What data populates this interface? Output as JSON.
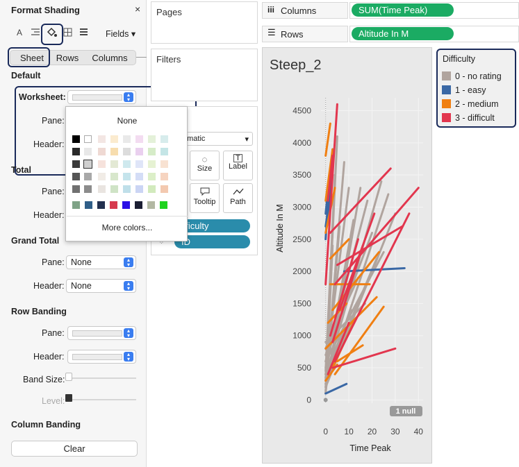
{
  "format_panel": {
    "title": "Format Shading",
    "close": "×",
    "toolbar": {
      "font_icon": "A",
      "fields": "Fields"
    },
    "tabs": [
      "Sheet",
      "Rows",
      "Columns"
    ],
    "default": {
      "heading": "Default",
      "worksheet_label": "Worksheet:",
      "pane_label": "Pane:",
      "header_label": "Header:"
    },
    "total": {
      "heading": "Total",
      "pane_label": "Pane:",
      "header_label": "Header:"
    },
    "grand_total": {
      "heading": "Grand Total",
      "pane_label": "Pane:",
      "pane_value": "None",
      "header_label": "Header:",
      "header_value": "None"
    },
    "row_banding": {
      "heading": "Row Banding",
      "pane_label": "Pane:",
      "header_label": "Header:",
      "band_size_label": "Band Size:",
      "level_label": "Level:"
    },
    "column_banding": {
      "heading": "Column Banding"
    },
    "clear_button": "Clear"
  },
  "color_popup": {
    "none_label": "None",
    "more_colors": "More colors...",
    "recent_colors": [
      "#7fa387",
      "#2f5e88",
      "#22304f",
      "#d63a4e",
      "#2a0fe6",
      "#1b1e33",
      "#b2b8a3",
      "#1fd31f"
    ]
  },
  "cards": {
    "pages": "Pages",
    "filters": "Filters",
    "mark_type": "omatic",
    "size": "Size",
    "label": "Label",
    "tooltip": "Tooltip",
    "path": "Path",
    "color_pill": "ifficulty",
    "detail_pill": "ID"
  },
  "shelves": {
    "columns_label": "Columns",
    "columns_pill": "SUM(Time Peak)",
    "rows_label": "Rows",
    "rows_pill": "Altitude In M"
  },
  "legend": {
    "title": "Difficulty",
    "items": [
      {
        "label": "0 - no rating",
        "color": "#b0a49e"
      },
      {
        "label": "1 - easy",
        "color": "#3a68a5"
      },
      {
        "label": "2 - medium",
        "color": "#f07f12"
      },
      {
        "label": "3 - difficult",
        "color": "#e2364e"
      }
    ]
  },
  "chart_data": {
    "type": "line",
    "title": "Steep_2",
    "xlabel": "Time Peak",
    "ylabel": "Altitude In M",
    "xlim": [
      -2,
      42
    ],
    "ylim": [
      -50,
      4700
    ],
    "x_ticks": [
      0,
      10,
      20,
      30,
      40
    ],
    "y_ticks": [
      0,
      500,
      1000,
      1500,
      2000,
      2500,
      3000,
      3500,
      4000,
      4500
    ],
    "null_indicator": "1 null",
    "series": [
      {
        "name": "0 - no rating",
        "color": "#b0a49e",
        "lines": [
          [
            [
              0,
              300
            ],
            [
              5,
              4100
            ]
          ],
          [
            [
              0,
              200
            ],
            [
              8,
              3700
            ]
          ],
          [
            [
              0,
              400
            ],
            [
              12,
              2800
            ]
          ],
          [
            [
              0,
              150
            ],
            [
              15,
              3300
            ]
          ],
          [
            [
              0,
              600
            ],
            [
              18,
              3100
            ]
          ],
          [
            [
              0,
              350
            ],
            [
              24,
              3400
            ]
          ],
          [
            [
              0,
              250
            ],
            [
              27,
              3200
            ]
          ],
          [
            [
              0,
              700
            ],
            [
              20,
              2600
            ]
          ],
          [
            [
              0,
              500
            ],
            [
              10,
              3300
            ]
          ],
          [
            [
              0,
              100
            ],
            [
              6,
              2700
            ]
          ],
          [
            [
              0,
              800
            ],
            [
              14,
              1900
            ]
          ],
          [
            [
              0,
              300
            ],
            [
              22,
              2200
            ]
          ],
          [
            [
              0,
              450
            ],
            [
              4,
              3500
            ]
          ],
          [
            [
              0,
              200
            ],
            [
              30,
              2900
            ]
          ],
          [
            [
              0,
              300
            ],
            [
              9,
              1700
            ]
          ],
          [
            [
              0,
              900
            ],
            [
              17,
              1500
            ]
          ],
          [
            [
              0,
              600
            ],
            [
              25,
              2300
            ]
          ],
          [
            [
              0,
              100
            ],
            [
              3,
              2400
            ]
          ],
          [
            [
              0,
              400
            ],
            [
              11,
              1400
            ]
          ],
          [
            [
              0,
              250
            ],
            [
              7,
              900
            ]
          ]
        ]
      },
      {
        "name": "1 - easy",
        "color": "#3a68a5",
        "lines": [
          [
            [
              0,
              2900
            ],
            [
              2,
              3600
            ]
          ],
          [
            [
              0,
              2500
            ],
            [
              1,
              3100
            ]
          ],
          [
            [
              1,
              2800
            ],
            [
              3,
              3900
            ]
          ],
          [
            [
              8,
              2000
            ],
            [
              34,
              2050
            ]
          ],
          [
            [
              0,
              100
            ],
            [
              9,
              250
            ]
          ],
          [
            [
              0,
              2700
            ],
            [
              2,
              3200
            ]
          ]
        ]
      },
      {
        "name": "2 - medium",
        "color": "#f07f12",
        "lines": [
          [
            [
              0,
              3800
            ],
            [
              2,
              4300
            ]
          ],
          [
            [
              0,
              3100
            ],
            [
              3,
              3900
            ]
          ],
          [
            [
              0,
              800
            ],
            [
              22,
              1600
            ]
          ],
          [
            [
              2,
              1800
            ],
            [
              19,
              1800
            ]
          ],
          [
            [
              3,
              500
            ],
            [
              12,
              1200
            ]
          ],
          [
            [
              4,
              400
            ],
            [
              25,
              1450
            ]
          ],
          [
            [
              0,
              2600
            ],
            [
              4,
              3300
            ]
          ],
          [
            [
              5,
              600
            ],
            [
              16,
              850
            ]
          ],
          [
            [
              1,
              1200
            ],
            [
              9,
              1500
            ]
          ],
          [
            [
              3,
              1400
            ],
            [
              23,
              2300
            ]
          ],
          [
            [
              0,
              300
            ],
            [
              5,
              550
            ]
          ],
          [
            [
              2,
              2200
            ],
            [
              10,
              2500
            ]
          ]
        ]
      },
      {
        "name": "3 - difficult",
        "color": "#e2364e",
        "lines": [
          [
            [
              3,
              3500
            ],
            [
              5,
              4600
            ]
          ],
          [
            [
              1,
              3100
            ],
            [
              3,
              3800
            ]
          ],
          [
            [
              2,
              2600
            ],
            [
              28,
              3600
            ]
          ],
          [
            [
              4,
              1800
            ],
            [
              40,
              3300
            ]
          ],
          [
            [
              5,
              2100
            ],
            [
              33,
              2700
            ]
          ],
          [
            [
              3,
              500
            ],
            [
              30,
              800
            ]
          ],
          [
            [
              2,
              1000
            ],
            [
              14,
              2500
            ]
          ],
          [
            [
              6,
              1400
            ],
            [
              21,
              2900
            ]
          ],
          [
            [
              1,
              400
            ],
            [
              10,
              1200
            ]
          ],
          [
            [
              4,
              600
            ],
            [
              36,
              2900
            ]
          ],
          [
            [
              0,
              1800
            ],
            [
              3,
              3500
            ]
          ],
          [
            [
              3,
              900
            ],
            [
              16,
              2400
            ]
          ]
        ]
      }
    ]
  }
}
